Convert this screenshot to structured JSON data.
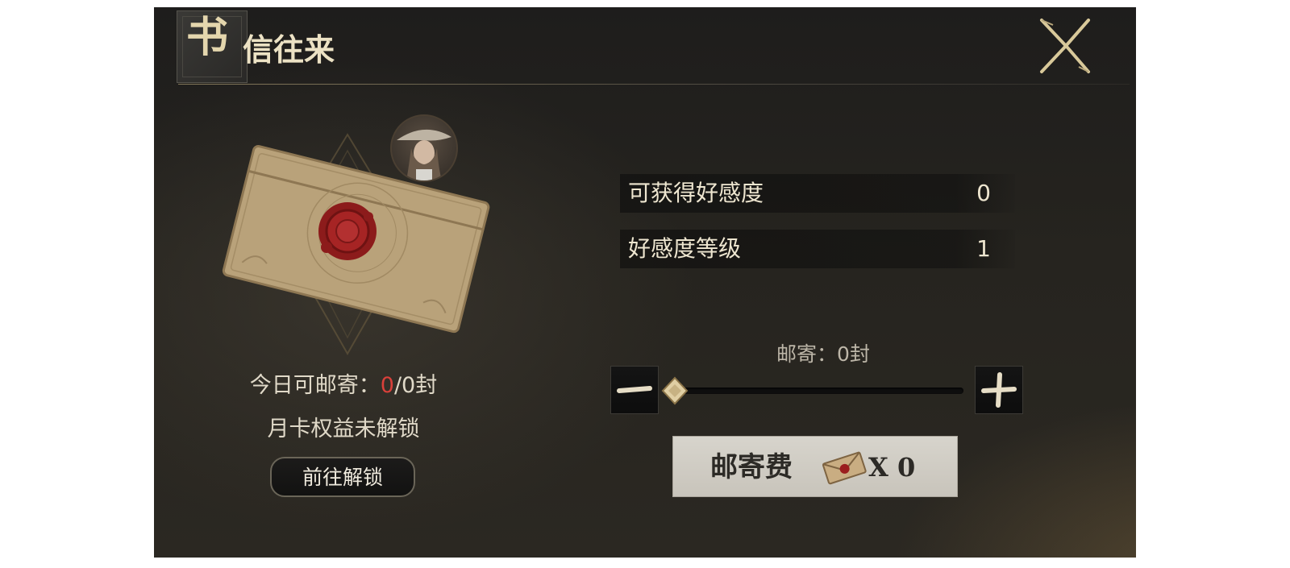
{
  "header": {
    "title_big": "书",
    "title_rest": "信往来"
  },
  "left": {
    "daily_label": "今日可邮寄：",
    "daily_used": "0",
    "daily_total": "/0封",
    "monthcard_text": "月卡权益未解锁",
    "unlock_button_label": "前往解锁"
  },
  "stats": {
    "favor_label": "可获得好感度",
    "favor_value": "0",
    "level_label": "好感度等级",
    "level_value": "1"
  },
  "sender": {
    "count_text": "邮寄：0封",
    "slider_value": 0,
    "postage_label": "邮寄费",
    "postage_count": "X 0"
  },
  "colors": {
    "accent_gold": "#e4d6ad",
    "highlight_red": "#d9403a",
    "wax_seal": "#9b1e1e"
  },
  "icons": [
    "close-icon",
    "letter-envelope-icon",
    "wax-seal-icon",
    "minus-icon",
    "plus-icon",
    "slider-diamond-icon",
    "postage-letter-icon",
    "character-avatar"
  ]
}
